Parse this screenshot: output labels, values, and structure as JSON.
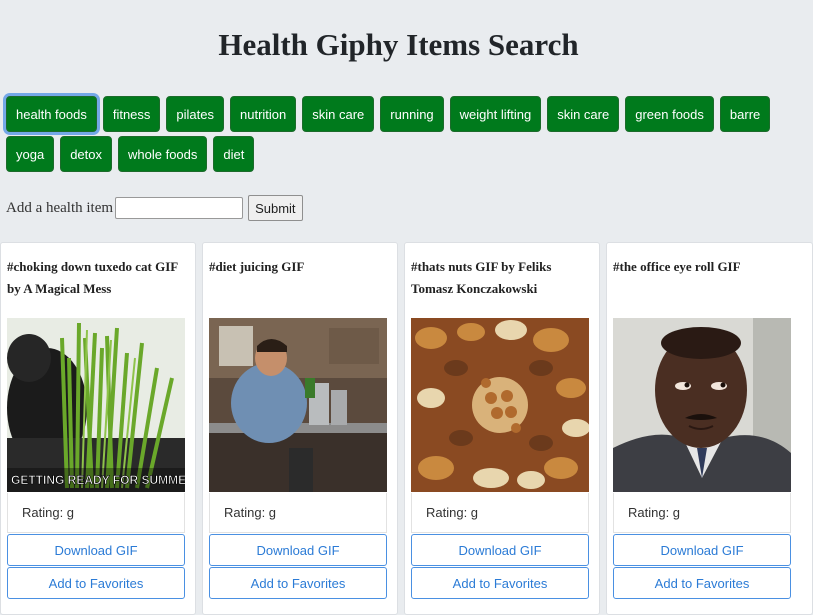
{
  "title": "Health Giphy Items Search",
  "topics": [
    {
      "label": "health foods",
      "active": true
    },
    {
      "label": "fitness"
    },
    {
      "label": "pilates"
    },
    {
      "label": "nutrition"
    },
    {
      "label": "skin care"
    },
    {
      "label": "running"
    },
    {
      "label": "weight lifting"
    },
    {
      "label": "skin care"
    },
    {
      "label": "green foods"
    },
    {
      "label": "barre"
    },
    {
      "label": "yoga"
    },
    {
      "label": "detox"
    },
    {
      "label": "whole foods"
    },
    {
      "label": "diet"
    }
  ],
  "form": {
    "label": "Add a health item",
    "input_value": "",
    "submit_label": "Submit"
  },
  "cards": [
    {
      "title": "#choking down tuxedo cat GIF by A Magical Mess",
      "image": "cat-grass-gif",
      "image_caption": "GETTING READY FOR SUMMER LIKE",
      "rating": "Rating: g",
      "download_label": "Download GIF",
      "favorite_label": "Add to Favorites"
    },
    {
      "title": "#diet juicing GIF",
      "image": "man-juicing-gif",
      "rating": "Rating: g",
      "download_label": "Download GIF",
      "favorite_label": "Add to Favorites"
    },
    {
      "title": "#thats nuts GIF by Feliks Tomasz Konczakowski",
      "image": "mixed-nuts-gif",
      "rating": "Rating: g",
      "download_label": "Download GIF",
      "favorite_label": "Add to Favorites"
    },
    {
      "title": "#the office eye roll GIF",
      "image": "office-eye-roll-gif",
      "rating": "Rating: g",
      "download_label": "Download GIF",
      "favorite_label": "Add to Favorites"
    }
  ],
  "colors": {
    "topic_button": "#007a1c",
    "active_outline": "#74a8e8",
    "link_blue": "#2b7bd6",
    "page_bg": "#e9ecef"
  }
}
